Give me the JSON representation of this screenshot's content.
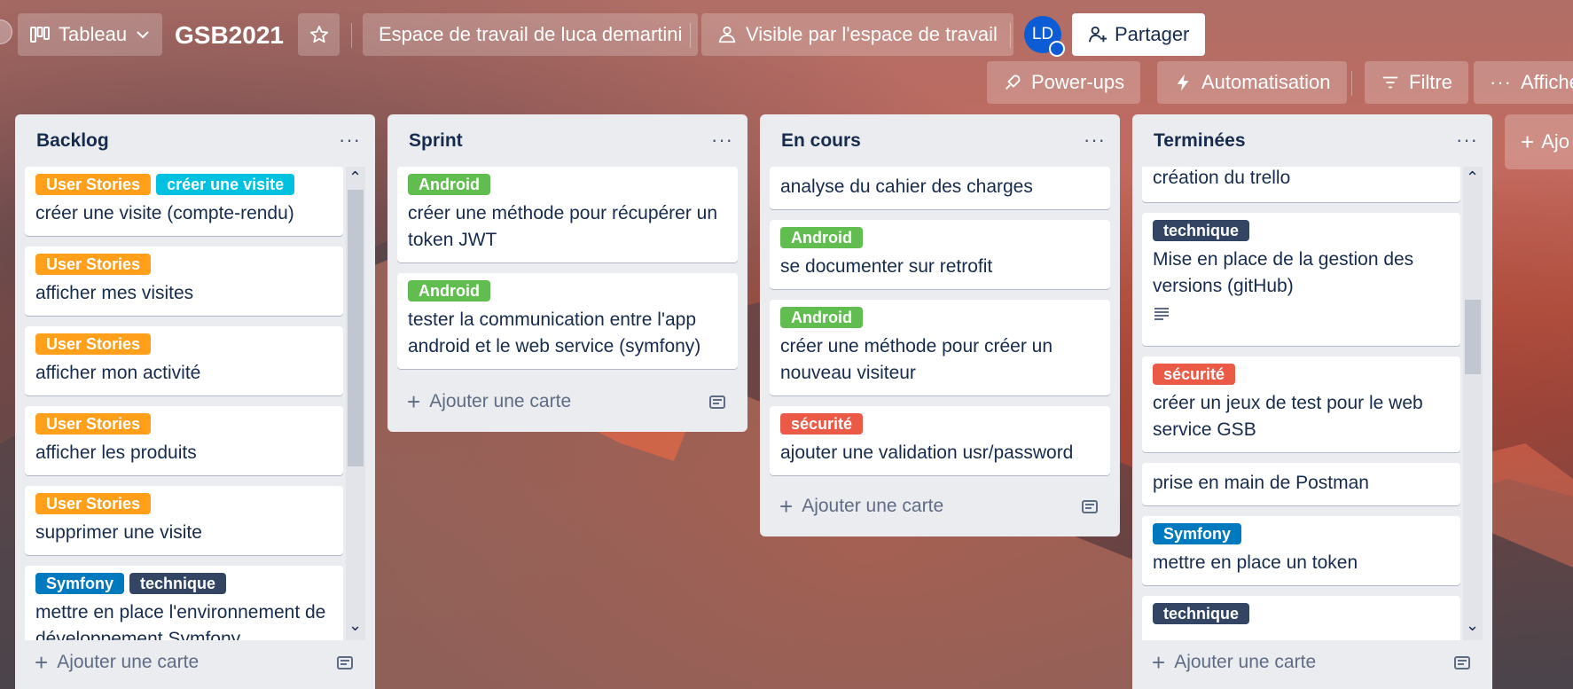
{
  "header": {
    "view_label": "Tableau",
    "board_title": "GSB2021",
    "workspace_label": "Espace de travail de luca demartini",
    "visibility_label": "Visible par l'espace de travail",
    "avatar_initials": "LD",
    "share_label": "Partager",
    "powerups_label": "Power-ups",
    "automation_label": "Automatisation",
    "filter_label": "Filtre",
    "more_label": "Afficher"
  },
  "lists": [
    {
      "title": "Backlog",
      "add_label": "Ajouter une carte",
      "cards": [
        {
          "labels": [
            {
              "text": "User Stories",
              "color": "#ff9f1a"
            },
            {
              "text": "créer une visite",
              "color": "#00c2e0"
            }
          ],
          "title": "créer une visite (compte-rendu)"
        },
        {
          "labels": [
            {
              "text": "User Stories",
              "color": "#ff9f1a"
            }
          ],
          "title": "afficher mes visites"
        },
        {
          "labels": [
            {
              "text": "User Stories",
              "color": "#ff9f1a"
            }
          ],
          "title": "afficher mon activité"
        },
        {
          "labels": [
            {
              "text": "User Stories",
              "color": "#ff9f1a"
            }
          ],
          "title": "afficher les produits"
        },
        {
          "labels": [
            {
              "text": "User Stories",
              "color": "#ff9f1a"
            }
          ],
          "title": "supprimer une visite"
        },
        {
          "labels": [
            {
              "text": "Symfony",
              "color": "#0079bf"
            },
            {
              "text": "technique",
              "color": "#344563"
            }
          ],
          "title": "mettre en place l'environnement de développement Symfony"
        }
      ]
    },
    {
      "title": "Sprint",
      "add_label": "Ajouter une carte",
      "cards": [
        {
          "labels": [
            {
              "text": "Android",
              "color": "#61bd4f"
            }
          ],
          "title": "créer une méthode pour récupérer un token JWT"
        },
        {
          "labels": [
            {
              "text": "Android",
              "color": "#61bd4f"
            }
          ],
          "title": "tester la communication entre l'app android et le web service (symfony)"
        }
      ]
    },
    {
      "title": "En cours",
      "add_label": "Ajouter une carte",
      "cards": [
        {
          "labels": [],
          "title": "analyse du cahier des charges"
        },
        {
          "labels": [
            {
              "text": "Android",
              "color": "#61bd4f"
            }
          ],
          "title": "se documenter sur retrofit"
        },
        {
          "labels": [
            {
              "text": "Android",
              "color": "#61bd4f"
            }
          ],
          "title": "créer une méthode pour créer un nouveau visiteur"
        },
        {
          "labels": [
            {
              "text": "sécurité",
              "color": "#eb5a46"
            }
          ],
          "title": "ajouter une validation usr/password"
        }
      ]
    },
    {
      "title": "Terminées",
      "add_label": "Ajouter une carte",
      "cards": [
        {
          "labels": [],
          "title": "création du trello"
        },
        {
          "labels": [
            {
              "text": "technique",
              "color": "#344563"
            }
          ],
          "title": "Mise en place de la gestion des versions (gitHub)",
          "has_description": true
        },
        {
          "labels": [
            {
              "text": "sécurité",
              "color": "#eb5a46"
            }
          ],
          "title": "créer un jeux de test pour le web service GSB"
        },
        {
          "labels": [],
          "title": "prise en main de Postman"
        },
        {
          "labels": [
            {
              "text": "Symfony",
              "color": "#0079bf"
            }
          ],
          "title": "mettre en place un token"
        },
        {
          "labels": [
            {
              "text": "technique",
              "color": "#344563"
            }
          ],
          "title": ""
        }
      ]
    }
  ],
  "add_list_label": "Ajo"
}
